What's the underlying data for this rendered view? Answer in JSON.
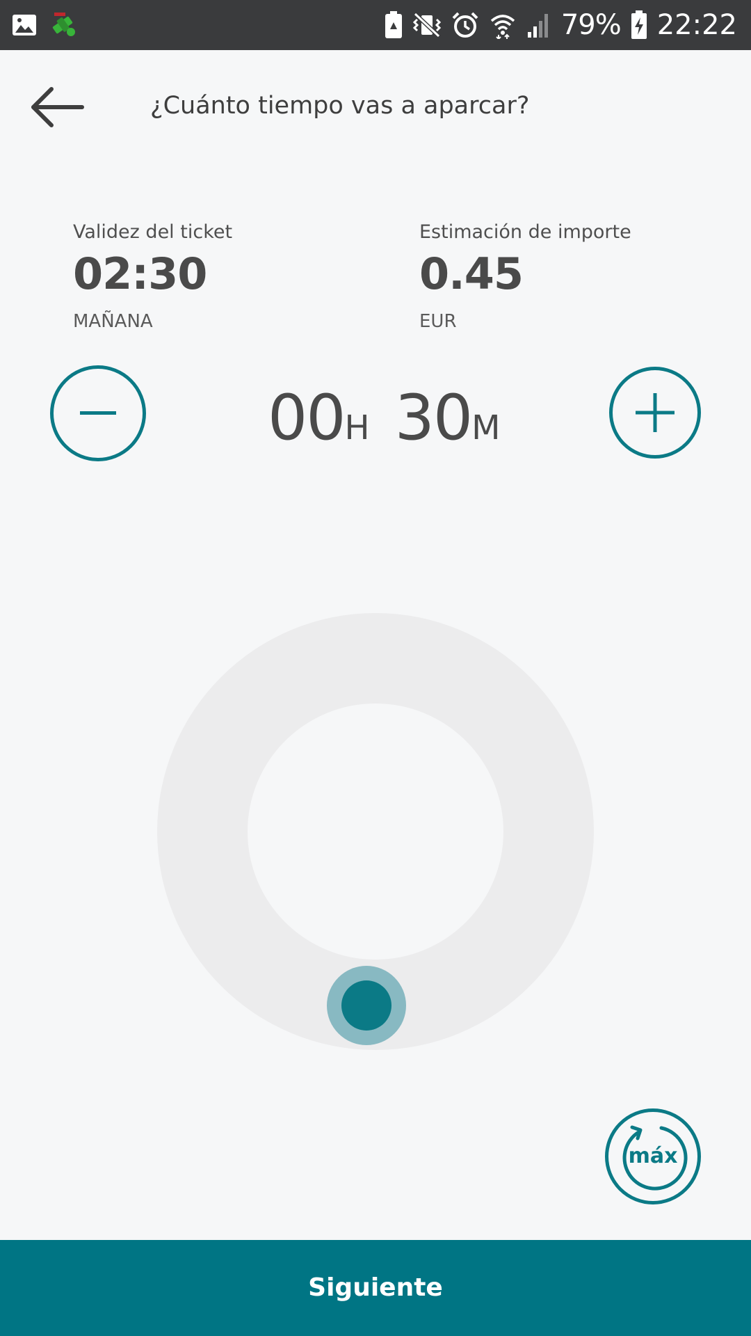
{
  "status_bar": {
    "icons_left": [
      "image-icon",
      "satellite-app-icon"
    ],
    "icons_right": [
      "battery-saver-icon",
      "vibrate-mute-icon",
      "alarm-icon",
      "wifi-icon",
      "signal-icon"
    ],
    "battery_percent": "79%",
    "time": "22:22"
  },
  "header": {
    "back_icon": "arrow-left-icon",
    "title": "¿Cuánto tiempo vas a aparcar?"
  },
  "info": {
    "validity": {
      "label": "Validez del ticket",
      "value": "02:30",
      "sub": "MAÑANA"
    },
    "estimate": {
      "label": "Estimación de importe",
      "value": "0.45",
      "sub": "EUR"
    }
  },
  "duration": {
    "hours": "00",
    "hours_unit": "H",
    "minutes": "30",
    "minutes_unit": "M",
    "minus_icon": "minus-icon",
    "plus_icon": "plus-icon"
  },
  "dial": {
    "handle_fraction": 0.52
  },
  "max_button": {
    "label": "máx",
    "icon": "refresh-arrow-icon"
  },
  "footer": {
    "next_label": "Siguiente"
  },
  "colors": {
    "accent": "#0b7a86",
    "footer": "#007584",
    "background": "#f6f7f8",
    "status_bar": "#3a3b3d",
    "dial_track": "#ececed",
    "handle_halo": "#88b9c2"
  }
}
